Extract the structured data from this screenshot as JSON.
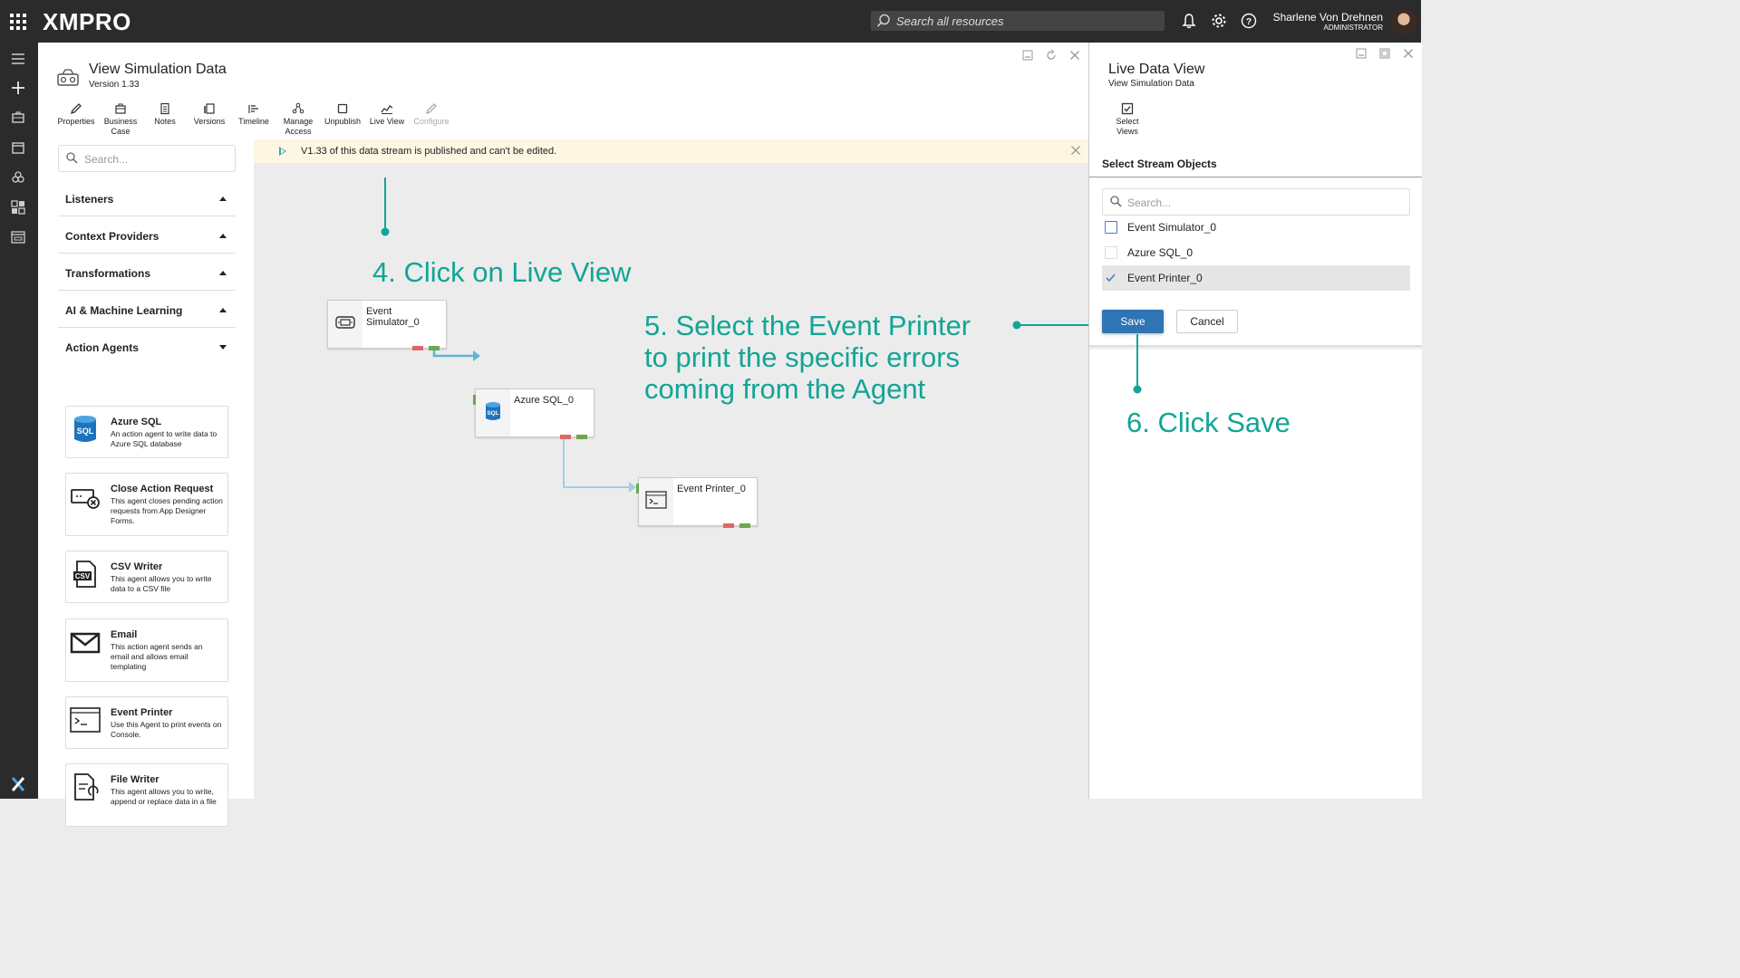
{
  "topbar": {
    "logo": "XMPRO",
    "search_placeholder": "Search all resources",
    "user_name": "Sharlene Von Drehnen",
    "user_role": "ADMINISTRATOR"
  },
  "header": {
    "title": "View Simulation Data",
    "version": "Version 1.33"
  },
  "toolbar": {
    "properties": "Properties",
    "business_case": "Business Case",
    "notes": "Notes",
    "versions": "Versions",
    "timeline": "Timeline",
    "manage_access": "Manage Access",
    "unpublish": "Unpublish",
    "live_view": "Live View",
    "configure": "Configure"
  },
  "sidebar": {
    "search_placeholder": "Search...",
    "categories": [
      "Listeners",
      "Context Providers",
      "Transformations",
      "AI & Machine Learning",
      "Action Agents"
    ],
    "agents": [
      {
        "name": "Azure SQL",
        "desc": "An action agent to write data to Azure SQL database",
        "icon": "sql-database-icon"
      },
      {
        "name": "Close Action Request",
        "desc": "This agent closes pending action requests from App Designer Forms.",
        "icon": "close-request-icon"
      },
      {
        "name": "CSV Writer",
        "desc": "This agent allows you to write data to a CSV file",
        "icon": "csv-file-icon"
      },
      {
        "name": "Email",
        "desc": "This action agent sends an email and allows email templating",
        "icon": "envelope-icon"
      },
      {
        "name": "Event Printer",
        "desc": "Use this Agent to print events on Console.",
        "icon": "console-icon"
      },
      {
        "name": "File Writer",
        "desc": "This agent allows you to write, append or replace data in a file",
        "icon": "file-write-icon"
      }
    ]
  },
  "banner": {
    "text": "V1.33 of this data stream is published and can't be edited."
  },
  "canvas": {
    "nodes": [
      {
        "name": "Event Simulator_0",
        "icon": "simulator-icon"
      },
      {
        "name": "Azure SQL_0",
        "icon": "sql-database-icon"
      },
      {
        "name": "Event Printer_0",
        "icon": "console-icon"
      }
    ]
  },
  "annotations": {
    "step4": "4. Click on Live View",
    "step5_l1": "5. Select the Event Printer",
    "step5_l2": "to print the specific errors",
    "step5_l3": "coming from the Agent",
    "step6": "6. Click Save",
    "color": "#12a596"
  },
  "right_panel": {
    "title": "Live Data View",
    "subtitle": "View Simulation Data",
    "select_views": "Select Views",
    "section_title": "Select Stream Objects",
    "search_placeholder": "Search...",
    "items": [
      {
        "label": "Event Simulator_0",
        "checked": false
      },
      {
        "label": "Azure SQL_0",
        "checked": false
      },
      {
        "label": "Event Printer_0",
        "checked": true
      }
    ],
    "save": "Save",
    "cancel": "Cancel"
  },
  "colors": {
    "topbar": "#2b2b2b",
    "primary_button": "#2f75b5",
    "annotation": "#12a596",
    "banner": "#fdf6e3"
  }
}
